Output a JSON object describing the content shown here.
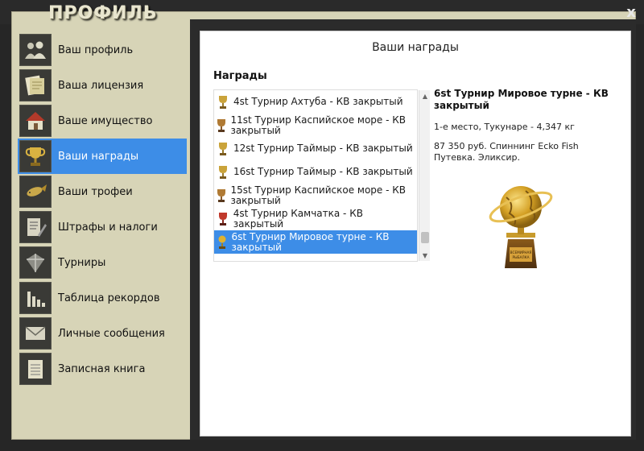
{
  "header": {
    "logo": "ПРОФИЛЬ",
    "close_label": "x"
  },
  "sidebar": {
    "items": [
      {
        "label": "Ваш профиль",
        "icon": "users-icon"
      },
      {
        "label": "Ваша лицензия",
        "icon": "license-icon"
      },
      {
        "label": "Ваше имущество",
        "icon": "house-icon"
      },
      {
        "label": "Ваши награды",
        "icon": "trophy-icon"
      },
      {
        "label": "Ваши трофеи",
        "icon": "fish-icon"
      },
      {
        "label": "Штрафы и налоги",
        "icon": "tax-icon"
      },
      {
        "label": "Турниры",
        "icon": "tournament-icon"
      },
      {
        "label": "Таблица рекордов",
        "icon": "chart-icon"
      },
      {
        "label": "Личные сообщения",
        "icon": "mail-icon"
      },
      {
        "label": "Записная книга",
        "icon": "notebook-icon"
      }
    ],
    "active_index": 3
  },
  "main": {
    "title": "Ваши награды",
    "section_label": "Награды",
    "awards": [
      {
        "label": "4st Турнир Ахтуба - КВ закрытый",
        "trophy_color": "#caa33a"
      },
      {
        "label": "11st Турнир Каспийское море - КВ закрытый",
        "trophy_color": "#b07a34"
      },
      {
        "label": "12st Турнир Таймыр - КВ закрытый",
        "trophy_color": "#caa33a"
      },
      {
        "label": "16st Турнир Таймыр - КВ закрытый",
        "trophy_color": "#caa33a"
      },
      {
        "label": "15st Турнир Каспийское море - КВ закрытый",
        "trophy_color": "#b07a34"
      },
      {
        "label": "4st Турнир Камчатка - КВ закрытый",
        "trophy_color": "#c0392b"
      },
      {
        "label": "6st Турнир Мировое турне - КВ закрытый",
        "trophy_color": "#e0b22f"
      }
    ],
    "selected_index": 6,
    "detail": {
      "title": "6st Турнир Мировое турне - КВ закрытый",
      "place": "1-е место, Тукунаре - 4,347 кг",
      "prize": "87 350 руб. Спиннинг Ecko Fish Путевка. Эликсир.",
      "trophy_plaque_text": "ВСЕМИРНАЯ РЫБАЛКА"
    }
  }
}
